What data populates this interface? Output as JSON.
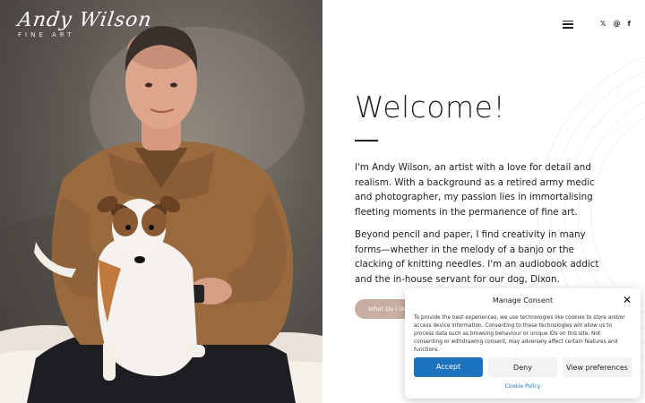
{
  "logo": {
    "script": "Andy Wilson",
    "sub": "FINE ART"
  },
  "nav": {
    "menu_icon": "hamburger-menu-icon",
    "social": [
      {
        "icon": "x-twitter-icon",
        "glyph": "𝕏"
      },
      {
        "icon": "threads-icon",
        "glyph": "@"
      },
      {
        "icon": "facebook-icon",
        "glyph": "f"
      }
    ]
  },
  "hero": {
    "heading": "Welcome!",
    "paragraph1": "I'm Andy Wilson, an artist with a love for detail and realism. With a background as a retired army medic and photographer, my passion lies in immortalising fleeting moments in the permanence of fine art.",
    "paragraph2": "Beyond pencil and paper, I find creativity in many forms—whether in the melody of a banjo or the clacking of knitting needles. I'm an audiobook addict and the in-house servant for our dog, Dixon.",
    "cta_label": "What Do I Do"
  },
  "consent": {
    "title": "Manage Consent",
    "text": "To provide the best experiences, we use technologies like cookies to store and/or access device information. Consenting to these technologies will allow us to process data such as browsing behaviour or unique IDs on this site. Not consenting or withdrawing consent, may adversely affect certain features and functions.",
    "accept": "Accept",
    "deny": "Deny",
    "preferences": "View preferences",
    "policy_link": "Cookie Policy",
    "close_glyph": "✕"
  },
  "colors": {
    "accent": "#1e73be",
    "cta": "#c8ada1",
    "text": "#222222"
  }
}
